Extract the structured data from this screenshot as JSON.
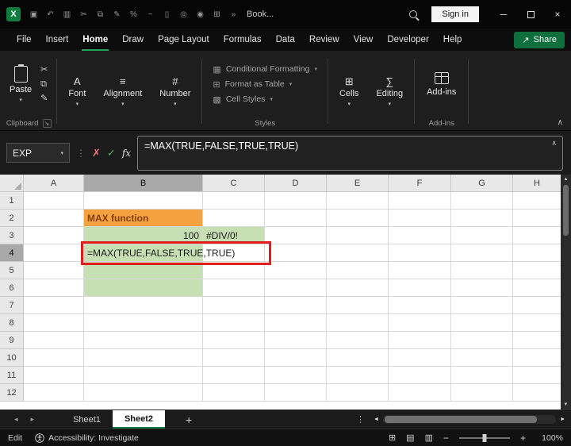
{
  "colors": {
    "accent_green": "#107C41",
    "orange_fill": "#F4A240",
    "orange_text": "#843C0C",
    "green_fill": "#C6E0B4",
    "red_annotation": "#E01E1E"
  },
  "icons": {
    "dropdown": "▾",
    "cut": "✂",
    "copy": "⧉",
    "format_painter": "✎",
    "dialog_launcher": "↘",
    "collapse_ribbon": "∧",
    "name_box_dropdown": "▾",
    "separator_dots": "⋮",
    "cancel": "✗",
    "enter": "✓",
    "formula_collapse": "∧",
    "scroll_up": "▲",
    "scroll_down": "▼",
    "sheet_nav_left": "◂",
    "sheet_nav_right": "▸",
    "scroll_left": "◄",
    "scroll_right": "►",
    "sheet_menu_dots": "⋮",
    "share_arrow": "↗",
    "minimize": "─",
    "close": "×",
    "normal_view": "⊞",
    "page_layout_view": "▤",
    "page_break_view": "▥",
    "zoom_out": "−",
    "zoom_in": "+"
  },
  "titlebar": {
    "logo_glyph": "X",
    "doc_title": "Book...",
    "sign_in_label": "Sign in",
    "qat_icons": [
      {
        "name": "save-icon",
        "glyph": "▣"
      },
      {
        "name": "undo-icon",
        "glyph": "↶"
      },
      {
        "name": "workbook-icon",
        "glyph": "▥"
      },
      {
        "name": "cut-icon",
        "glyph": "✂"
      },
      {
        "name": "copy-icon",
        "glyph": "⧉"
      },
      {
        "name": "format-painter-icon",
        "glyph": "✎"
      },
      {
        "name": "percent-style-icon",
        "glyph": "%"
      },
      {
        "name": "draw-icon",
        "glyph": "~"
      },
      {
        "name": "new-document-icon",
        "glyph": "▯"
      },
      {
        "name": "link-icon",
        "glyph": "◎"
      },
      {
        "name": "camera-icon",
        "glyph": "◉"
      },
      {
        "name": "table-icon",
        "glyph": "⊞"
      },
      {
        "name": "more-commands-icon",
        "glyph": "»"
      }
    ]
  },
  "ribbon": {
    "tabs": [
      "File",
      "Insert",
      "Home",
      "Draw",
      "Page Layout",
      "Formulas",
      "Data",
      "Review",
      "View",
      "Developer",
      "Help"
    ],
    "active_tab": "Home",
    "share_label": "Share",
    "clipboard": {
      "paste_label": "Paste",
      "group_label": "Clipboard"
    },
    "collapsed_groups": [
      {
        "name": "font",
        "label": "Font",
        "glyph": "A"
      },
      {
        "name": "alignment",
        "label": "Alignment",
        "glyph": "≡"
      },
      {
        "name": "number",
        "label": "Number",
        "glyph": "#"
      }
    ],
    "styles": {
      "group_label": "Styles",
      "items": [
        {
          "name": "conditional-formatting",
          "label": "Conditional Formatting",
          "glyph": "▦"
        },
        {
          "name": "format-as-table",
          "label": "Format as Table",
          "glyph": "⊞"
        },
        {
          "name": "cell-styles",
          "label": "Cell Styles",
          "glyph": "▩"
        }
      ]
    },
    "right_groups": [
      {
        "name": "cells",
        "label": "Cells",
        "glyph": "⊞"
      },
      {
        "name": "editing",
        "label": "Editing",
        "glyph": "∑"
      }
    ],
    "addins": {
      "button_label": "Add-ins",
      "group_label": "Add-ins"
    }
  },
  "formula_bar": {
    "name_box": "EXP",
    "fx_label": "fx",
    "formula": "=MAX(TRUE,FALSE,TRUE,TRUE)"
  },
  "grid": {
    "columns": [
      "A",
      "B",
      "C",
      "D",
      "E",
      "F",
      "G",
      "H"
    ],
    "rows": [
      "1",
      "2",
      "3",
      "4",
      "5",
      "6",
      "7",
      "8",
      "9",
      "10",
      "11",
      "12"
    ],
    "selected_column": "B",
    "selected_row": "4",
    "cells": [
      {
        "ref": "B2",
        "text": "MAX function",
        "fill": "orange",
        "bold": true,
        "color": "orange_text"
      },
      {
        "ref": "B3",
        "text": "100",
        "fill": "green",
        "align": "right"
      },
      {
        "ref": "C3",
        "text": "#DIV/0!",
        "fill": "green"
      },
      {
        "ref": "B4",
        "text": "=MAX(TRUE,FALSE,TRUE,TRUE)",
        "fill": "green",
        "overflow": true
      },
      {
        "ref": "B5",
        "text": "",
        "fill": "green"
      },
      {
        "ref": "B6",
        "text": "",
        "fill": "green"
      }
    ],
    "annotation": {
      "shape": "red-box",
      "target": "B4"
    }
  },
  "sheet_bar": {
    "tabs": [
      "Sheet1",
      "Sheet2"
    ],
    "active_tab": "Sheet2",
    "add_label": "+"
  },
  "status_bar": {
    "mode": "Edit",
    "accessibility": "Accessibility: Investigate",
    "zoom": "100%"
  }
}
